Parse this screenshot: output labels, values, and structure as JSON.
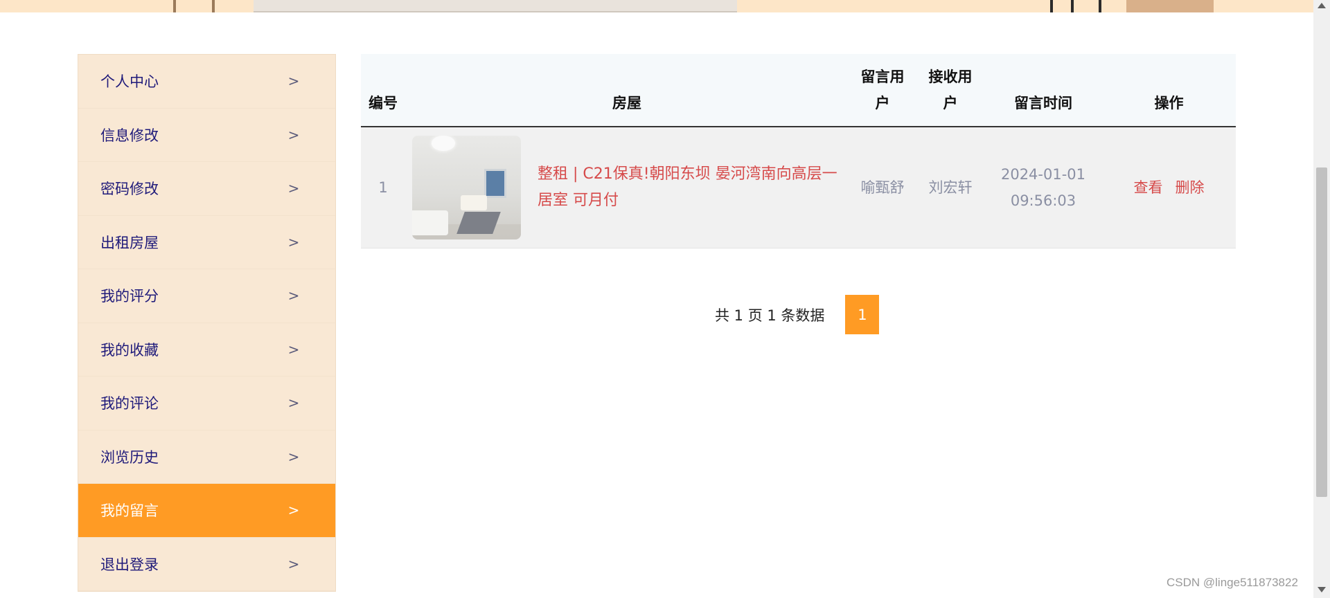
{
  "sidebar": {
    "items": [
      {
        "label": "个人中心",
        "chev": ">"
      },
      {
        "label": "信息修改",
        "chev": ">"
      },
      {
        "label": "密码修改",
        "chev": ">"
      },
      {
        "label": "出租房屋",
        "chev": ">"
      },
      {
        "label": "我的评分",
        "chev": ">"
      },
      {
        "label": "我的收藏",
        "chev": ">"
      },
      {
        "label": "我的评论",
        "chev": ">"
      },
      {
        "label": "浏览历史",
        "chev": ">"
      },
      {
        "label": "我的留言",
        "chev": ">",
        "active": true
      },
      {
        "label": "退出登录",
        "chev": ">"
      }
    ]
  },
  "table": {
    "headers": {
      "no": "编号",
      "house": "房屋",
      "from": "留言用户",
      "to": "接收用户",
      "time": "留言时间",
      "ops": "操作"
    },
    "rows": [
      {
        "no": "1",
        "house_title": "整租 | C21保真!朝阳东坝 晏河湾南向高层一居室 可月付",
        "from_user": "喻甄舒",
        "to_user": "刘宏轩",
        "time": "2024-01-01 09:56:03",
        "view": "查看",
        "delete": "删除"
      }
    ]
  },
  "pagination": {
    "info": "共 1 页 1 条数据",
    "current": "1"
  },
  "watermark": "CSDN @linge511873822",
  "colors": {
    "accent": "#ff9b24",
    "sidebar_bg": "#f9e8d4",
    "link_red": "#d64a4a",
    "sidebar_text": "#1f1a7a"
  }
}
